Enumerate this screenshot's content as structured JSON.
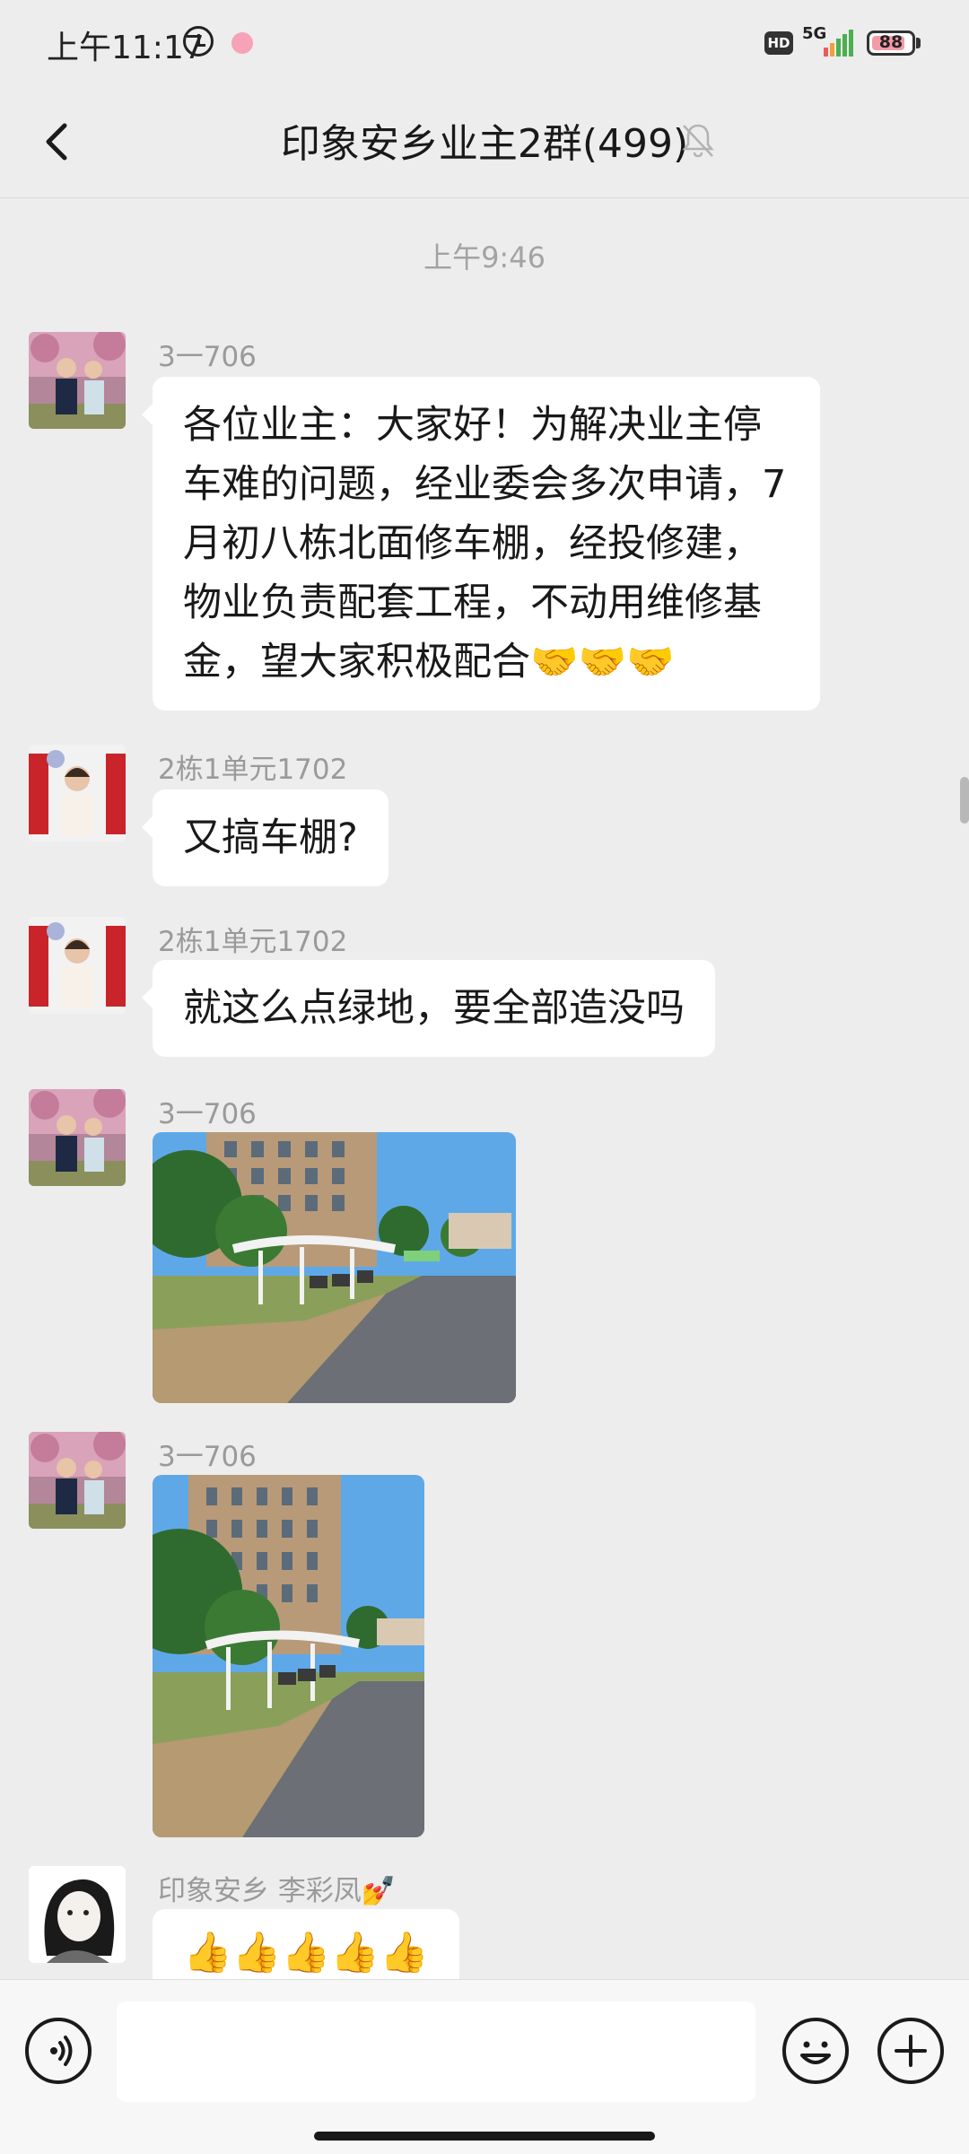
{
  "status_bar": {
    "time": "上午11:17",
    "network": "5G",
    "hd": "HD",
    "battery": "88",
    "battery_level": 0.88
  },
  "header": {
    "title": "印象安乡业主2群(499)",
    "back_icon": "chevron-left-icon",
    "mute_icon": "bell-off-icon"
  },
  "chat": {
    "timestamp": "上午9:46",
    "messages": [
      {
        "sender": "3一706",
        "text": "各位业主：大家好！为解决业主停车难的问题，经业委会多次申请，7月初八栋北面修车棚，经投修建，物业负责配套工程，不动用维修基金，望大家积极配合🤝🤝🤝"
      },
      {
        "sender": "2栋1单元1702",
        "text": "又搞车棚?"
      },
      {
        "sender": "2栋1单元1702",
        "text": "就这么点绿地，要全部造没吗"
      },
      {
        "sender": "3一706",
        "type": "image"
      },
      {
        "sender": "3一706",
        "type": "image"
      },
      {
        "sender": "印象安乡 李彩凤💅",
        "text": "👍👍👍👍👍"
      }
    ]
  },
  "input_bar": {
    "placeholder": "",
    "voice_icon": "voice-icon",
    "emoji_icon": "emoji-icon",
    "plus_icon": "plus-icon"
  }
}
